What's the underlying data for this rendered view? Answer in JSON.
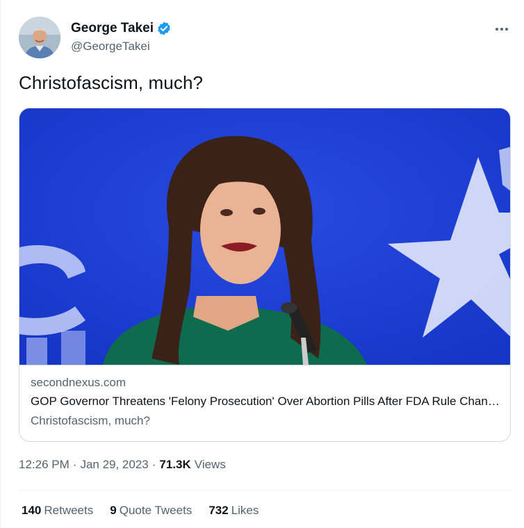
{
  "author": {
    "display_name": "George Takei",
    "handle": "@GeorgeTakei",
    "verified_color": "#1d9bf0"
  },
  "tweet": {
    "text": "Christofascism, much?"
  },
  "card": {
    "domain": "secondnexus.com",
    "title": "GOP Governor Threatens 'Felony Prosecution' Over Abortion Pills After FDA Rule Change",
    "description": "Christofascism, much?",
    "image_background": "#1f3fd6"
  },
  "meta": {
    "time": "12:26 PM",
    "separator": "·",
    "date": "Jan 29, 2023",
    "views_count": "71.3K",
    "views_label": "Views"
  },
  "stats": {
    "retweets_count": "140",
    "retweets_label": "Retweets",
    "quotes_count": "9",
    "quotes_label": "Quote Tweets",
    "likes_count": "732",
    "likes_label": "Likes"
  },
  "icons": {
    "verified": "verified-badge-icon",
    "more": "more-options-icon"
  }
}
